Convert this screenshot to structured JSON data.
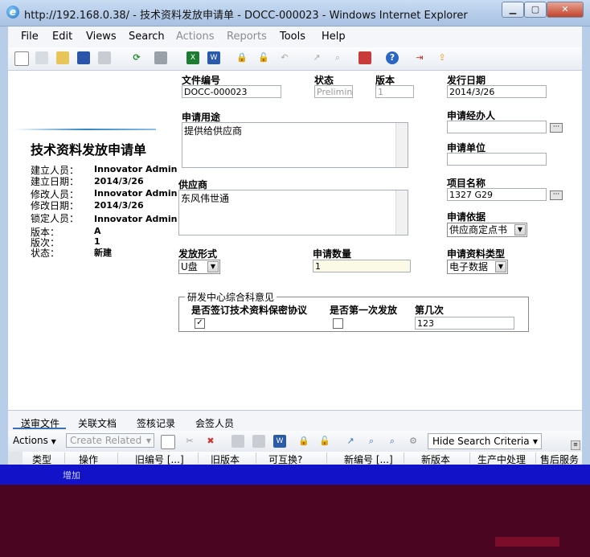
{
  "window": {
    "title": "http://192.168.0.38/ - 技术资料发放申请单 - DOCC-000023 - Windows Internet Explorer"
  },
  "menu": {
    "items": [
      {
        "label": "File",
        "enabled": true
      },
      {
        "label": "Edit",
        "enabled": true
      },
      {
        "label": "Views",
        "enabled": true
      },
      {
        "label": "Search",
        "enabled": true
      },
      {
        "label": "Actions",
        "enabled": false
      },
      {
        "label": "Reports",
        "enabled": false
      },
      {
        "label": "Tools",
        "enabled": true
      },
      {
        "label": "Help",
        "enabled": true
      }
    ]
  },
  "sidebar": {
    "title": "技术资料发放申请单",
    "meta": [
      {
        "key": "建立人员：",
        "value": "Innovator Admin"
      },
      {
        "key": "建立日期：",
        "value": "2014/3/26"
      },
      {
        "key": "修改人员：",
        "value": "Innovator Admin"
      },
      {
        "key": "修改日期：",
        "value": "2014/3/26"
      },
      {
        "key": "锁定人员：",
        "value": "Innovator Admin"
      },
      {
        "key": "版本：",
        "value": "A"
      },
      {
        "key": "版次：",
        "value": "1"
      },
      {
        "key": "状态：",
        "value": "新建"
      }
    ]
  },
  "form": {
    "doc_no_label": "文件编号",
    "doc_no": "DOCC-000023",
    "status_label": "状态",
    "status": "Preliminar",
    "version_label": "版本",
    "version": "1",
    "issue_date_label": "发行日期",
    "issue_date": "2014/3/26",
    "purpose_label": "申请用途",
    "purpose": "提供给供应商",
    "handler_label": "申请经办人",
    "handler": "",
    "unit_label": "申请单位",
    "unit": "",
    "supplier_label": "供应商",
    "supplier": "东风伟世通",
    "project_label": "项目名称",
    "project": "1327 G29",
    "basis_label": "申请依据",
    "basis": "供应商定点书",
    "release_form_label": "发放形式",
    "release_form": "U盘",
    "quantity_label": "申请数量",
    "quantity": "1",
    "doc_type_label": "申请资料类型",
    "doc_type": "电子数据",
    "opinion_group_label": "研发中心综合科意见",
    "nda_label": "是否签订技术资料保密协议",
    "nda_checked": true,
    "first_release_label": "是否第一次发放",
    "first_release_checked": false,
    "nth_label": "第几次",
    "nth": "123"
  },
  "relationships": {
    "tabs": [
      "送审文件",
      "关联文档",
      "签核记录",
      "会签人员"
    ],
    "actions_label": "Actions",
    "create_related_label": "Create Related",
    "hide_search_label": "Hide Search Criteria",
    "columns": [
      "类型",
      "操作",
      "旧编号 [...]",
      "旧版本",
      "可互换?",
      "新编号 [...]",
      "新版本",
      "生产中处理",
      "售后服务"
    ],
    "row_op": "增加"
  },
  "colors": {
    "accent": "#3a6fb6",
    "frame": "#b8cde8",
    "overlay_blue": "#1212c8",
    "overlay_dark": "#4a0520"
  }
}
